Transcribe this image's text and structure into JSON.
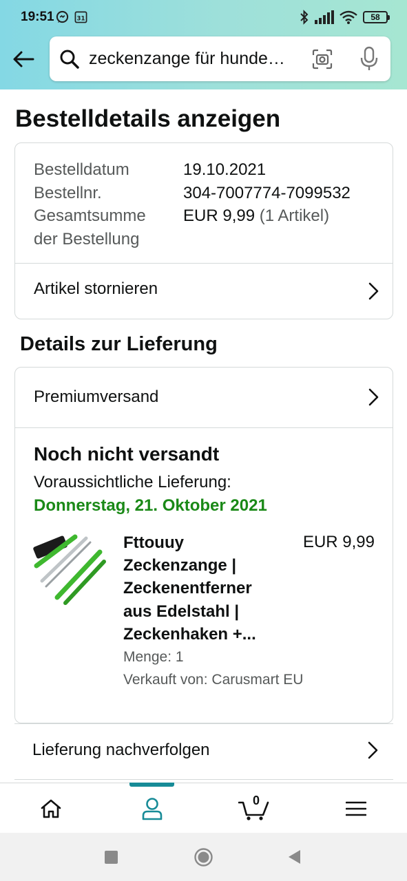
{
  "status_bar": {
    "time": "19:51",
    "calendar_day": "31",
    "battery": "58"
  },
  "search": {
    "query": "zeckenzange für hunde…"
  },
  "page": {
    "title": "Bestelldetails anzeigen"
  },
  "order": {
    "rows": [
      {
        "label": "Bestelldatum",
        "value": "19.10.2021"
      },
      {
        "label": "Bestellnr.",
        "value": "304-7007774-7099532"
      },
      {
        "label": "Gesamtsumme",
        "value": "EUR 9,99",
        "suffix": "(1 Artikel)"
      },
      {
        "label": "der Bestellung",
        "value": ""
      }
    ],
    "cancel_label": "Artikel stornieren"
  },
  "delivery": {
    "section_title": "Details zur Lieferung",
    "shipping_method": "Premiumversand",
    "status": "Noch nicht versandt",
    "eta_label": "Voraussichtliche Lieferung:",
    "eta_date": "Donnerstag, 21. Oktober 2021",
    "product": {
      "title_lines": [
        "Fttouuy",
        "Zeckenzange |",
        "Zeckenentferner",
        "aus Edelstahl |",
        "Zeckenhaken +..."
      ],
      "price": "EUR 9,99",
      "quantity": "Menge: 1",
      "seller": "Verkauft von: Carusmart EU"
    },
    "track_label": "Lieferung nachverfolgen"
  },
  "bottom_nav": {
    "items": [
      "home-icon",
      "account-icon",
      "cart-icon",
      "menu-icon"
    ],
    "active": "account-icon",
    "cart_count": "0"
  },
  "colors": {
    "accent": "#178b97",
    "eta_green": "#1a8917",
    "text": "#0f1111",
    "muted": "#565959",
    "border": "#d5d9d9"
  }
}
